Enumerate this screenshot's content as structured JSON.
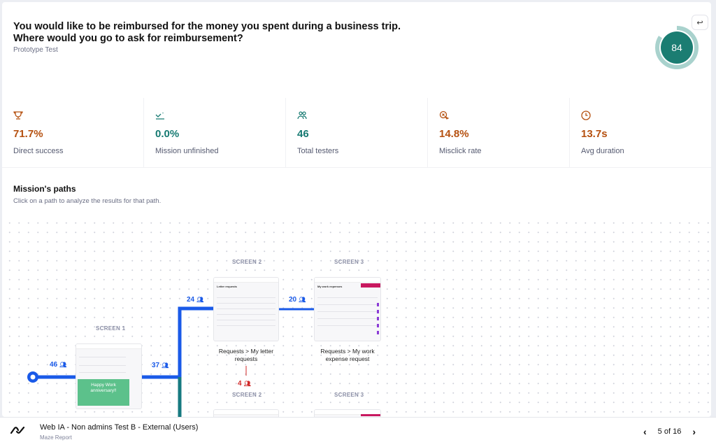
{
  "header": {
    "question": "You would like to be reimbursed for the money you spent during a business trip. Where would you go to ask for reimbursement?",
    "question_line1": "You would like to be reimbursed for the money you spent during a business trip.",
    "question_line2": "Where would you go to ask for reimbursement?",
    "subtitle": "Prototype Test",
    "undo_icon": "undo-icon",
    "score": "84",
    "score_fraction": 0.84,
    "score_color": "#1b7d72",
    "score_ring_color": "#a9d2cd"
  },
  "metrics": [
    {
      "icon": "trophy-icon",
      "value": "71.7%",
      "label": "Direct success",
      "color": "#b5500f"
    },
    {
      "icon": "bounce-icon",
      "value": "0.0%",
      "label": "Mission unfinished",
      "color": "#167a72"
    },
    {
      "icon": "users-icon",
      "value": "46",
      "label": "Total testers",
      "color": "#167a72"
    },
    {
      "icon": "misclick-icon",
      "value": "14.8%",
      "label": "Misclick rate",
      "color": "#b5500f"
    },
    {
      "icon": "clock-icon",
      "value": "13.7s",
      "label": "Avg duration",
      "color": "#b5500f"
    }
  ],
  "paths": {
    "title": "Mission's paths",
    "subtitle": "Click on a path to analyze the results for that path.",
    "path_color": "#1a5ae8",
    "alt_path_color": "#177a80",
    "misclick_color": "#d12a2a",
    "start_count": "46",
    "screens": [
      {
        "label": "SCREEN 1",
        "caption": "",
        "thumb_text": "Happy Work anniversary!!",
        "count_out": "37"
      },
      {
        "label": "SCREEN 2",
        "caption": "Requests > My letter requests",
        "thumb_title": "Letter requests",
        "count_in": "24",
        "count_out": "20",
        "misclicks": "4"
      },
      {
        "label": "SCREEN 3",
        "caption": "Requests > My work expense request",
        "thumb_title": "My work expenses"
      },
      {
        "label": "SCREEN 2",
        "caption": ""
      },
      {
        "label": "SCREEN 3",
        "caption": ""
      }
    ]
  },
  "footer": {
    "title": "Web IA - Non admins Test B - External (Users)",
    "subtitle": "Maze Report",
    "page_indicator": "5 of 16",
    "prev_icon": "chevron-left-icon",
    "next_icon": "chevron-right-icon"
  }
}
